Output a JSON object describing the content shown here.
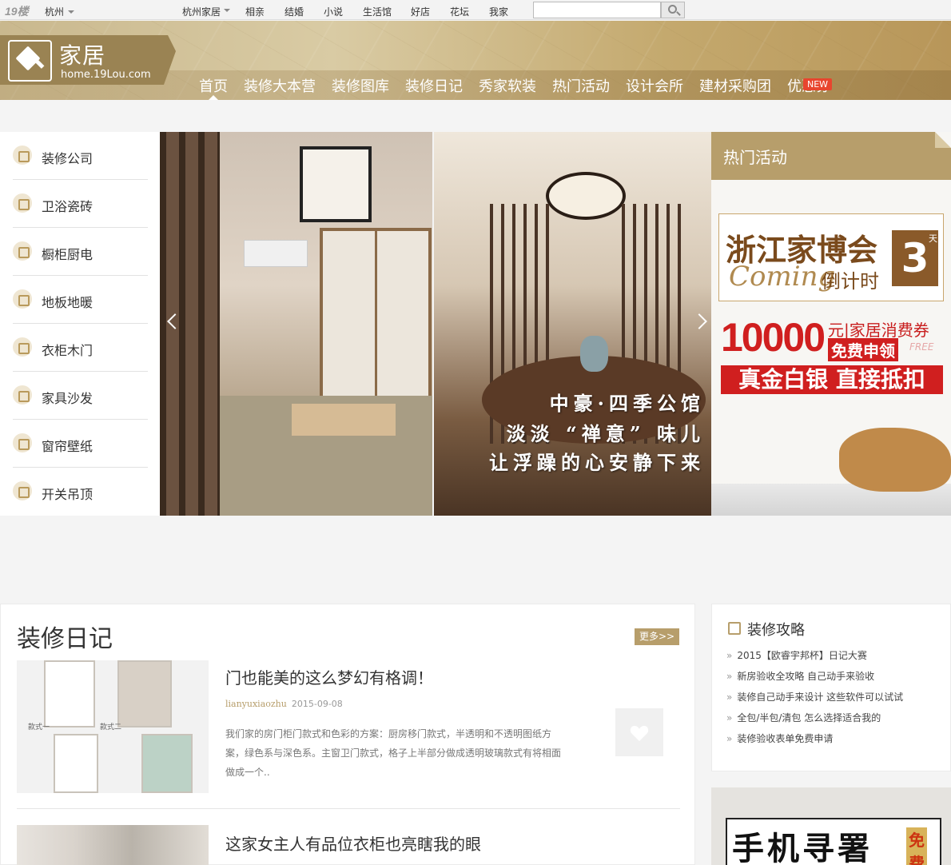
{
  "topbar": {
    "logo": "19楼",
    "city": "杭州",
    "nav": [
      "杭州家居",
      "相亲",
      "结婚",
      "小说",
      "生活馆",
      "好店",
      "花坛",
      "我家"
    ],
    "search_placeholder": ""
  },
  "header": {
    "brand_name": "家居",
    "brand_url": "home.19Lou.com",
    "nav": [
      "首页",
      "装修大本营",
      "装修图库",
      "装修日记",
      "秀家软装",
      "热门活动",
      "设计会所",
      "建材采购团",
      "优惠券"
    ],
    "new_badge": "NEW"
  },
  "categories": [
    "装修公司",
    "卫浴瓷砖",
    "橱柜厨电",
    "地板地暖",
    "衣柜木门",
    "家具沙发",
    "窗帘壁纸",
    "开关吊顶"
  ],
  "slider": {
    "caption_lines": [
      "中豪·四季公馆",
      "淡淡 “禅意” 味儿",
      "让浮躁的心安静下来"
    ]
  },
  "hot": {
    "title": "热门活动",
    "expo_title": "浙江家博会",
    "expo_coming": "Coming",
    "expo_countdown": "倒计时",
    "expo_number": "3",
    "expo_day": "天",
    "coupon_amount": "10000",
    "coupon_unit": "元|家居消费券",
    "coupon_free": "免费申领",
    "coupon_free_en": "FREE",
    "cash_line": "真金白银 直接抵扣"
  },
  "diary": {
    "title": "装修日记",
    "more": "更多>>",
    "articles": [
      {
        "title": "门也能美的这么梦幻有格调！",
        "author": "lianyuxiaozhu",
        "date": "2015-09-08",
        "excerpt": "我们家的房门柜门款式和色彩的方案：厨房移门款式，半透明和不透明图纸方案，绿色系与深色系。主窗卫门款式，格子上半部分做成透明玻璃款式有将相面做成一个..",
        "thumb_labels": [
          "款式一",
          "款式二"
        ]
      },
      {
        "title": "这家女主人有品位衣柜也亮瞎我的眼"
      }
    ]
  },
  "tips": {
    "title": "装修攻略",
    "items": [
      "2015【欧睿宇邦杯】日记大赛",
      "新房验收全攻略 自己动手来验收",
      "装修自己动手来设计 这些软件可以试试",
      "全包/半包/清包 怎么选择适合我的",
      "装修验收表单免费申请"
    ]
  },
  "ad_bottom": {
    "text": "手机寻署",
    "tag": "免费"
  },
  "colors": {
    "accent": "#b79e6b",
    "red": "#d01f1f",
    "new_badge": "#e8452e"
  }
}
